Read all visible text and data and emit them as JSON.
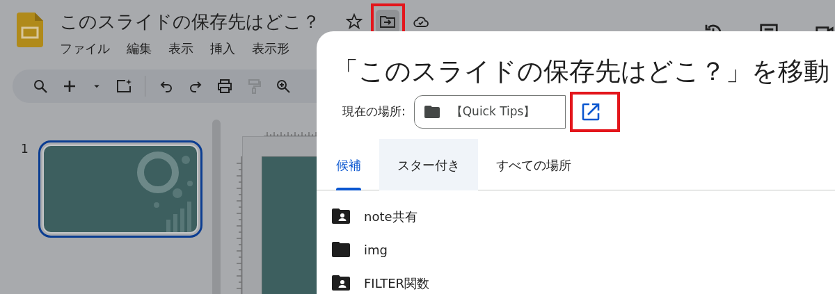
{
  "app": {
    "title": "このスライドの保存先はどこ？",
    "title_actions": [
      {
        "kind": "star",
        "highlighted": false
      },
      {
        "kind": "move",
        "highlighted": true
      },
      {
        "kind": "cloud",
        "highlighted": false
      }
    ],
    "menu": [
      "ファイル",
      "編集",
      "表示",
      "挿入",
      "表示形"
    ],
    "toolbar": [
      {
        "kind": "search",
        "disabled": false
      },
      {
        "kind": "plus",
        "disabled": false
      },
      {
        "kind": "caret",
        "disabled": false
      },
      {
        "kind": "spark",
        "disabled": false
      },
      {
        "kind": "sep",
        "disabled": false
      },
      {
        "kind": "undo",
        "disabled": false
      },
      {
        "kind": "redo",
        "disabled": false
      },
      {
        "kind": "print",
        "disabled": false
      },
      {
        "kind": "paint",
        "disabled": true
      },
      {
        "kind": "zoom",
        "disabled": false
      }
    ],
    "header_right": [
      {
        "kind": "history"
      },
      {
        "kind": "comments"
      },
      {
        "kind": "video"
      }
    ]
  },
  "slides": [
    {
      "number": "1",
      "selected": true
    }
  ],
  "dialog": {
    "title": "「このスライドの保存先はどこ？」を移動",
    "location_label": "現在の場所:",
    "location": "【Quick Tips】",
    "open_button": {
      "highlighted": true
    },
    "tabs": [
      {
        "label": "候補",
        "selected": true,
        "hovered": false
      },
      {
        "label": "スター付き",
        "selected": false,
        "hovered": true
      },
      {
        "label": "すべての場所",
        "selected": false,
        "hovered": false
      }
    ],
    "folders": [
      {
        "name": "note共有",
        "kind": "shared"
      },
      {
        "name": "img",
        "kind": "folder"
      },
      {
        "name": "FILTER関数",
        "kind": "shared"
      }
    ]
  }
}
